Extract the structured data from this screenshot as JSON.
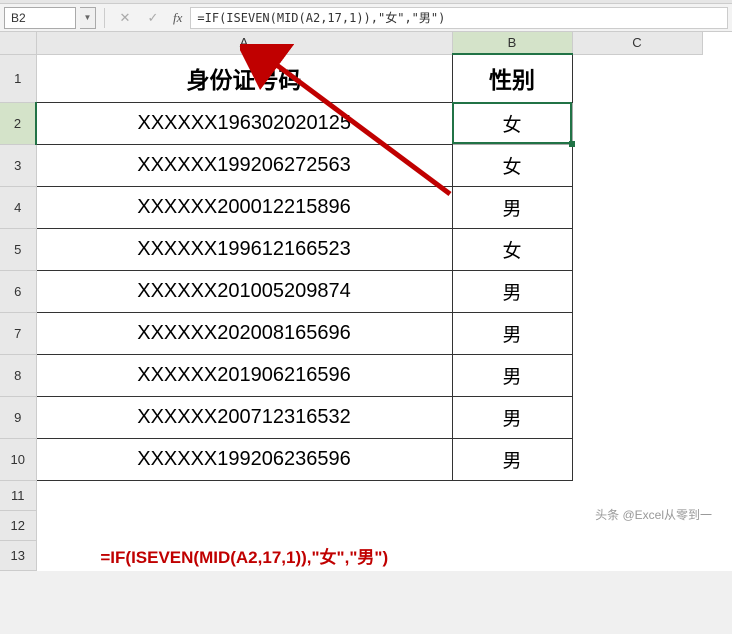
{
  "name_box": "B2",
  "formula_bar": "=IF(ISEVEN(MID(A2,17,1)),\"女\",\"男\")",
  "col_headers": {
    "A": "A",
    "B": "B",
    "C": "C"
  },
  "row_headers": [
    "1",
    "2",
    "3",
    "4",
    "5",
    "6",
    "7",
    "8",
    "9",
    "10",
    "11",
    "12",
    "13"
  ],
  "table": {
    "header_A": "身份证号码",
    "header_B": "性别",
    "rows": [
      {
        "id": "XXXXXX196302020125",
        "gender": "女"
      },
      {
        "id": "XXXXXX199206272563",
        "gender": "女"
      },
      {
        "id": "XXXXXX200012215896",
        "gender": "男"
      },
      {
        "id": "XXXXXX199612166523",
        "gender": "女"
      },
      {
        "id": "XXXXXX201005209874",
        "gender": "男"
      },
      {
        "id": "XXXXXX202008165696",
        "gender": "男"
      },
      {
        "id": "XXXXXX201906216596",
        "gender": "男"
      },
      {
        "id": "XXXXXX200712316532",
        "gender": "男"
      },
      {
        "id": "XXXXXX199206236596",
        "gender": "男"
      }
    ]
  },
  "formula_display": "=IF(ISEVEN(MID(A2,17,1)),\"女\",\"男\")",
  "watermark": "头条 @Excel从零到一"
}
